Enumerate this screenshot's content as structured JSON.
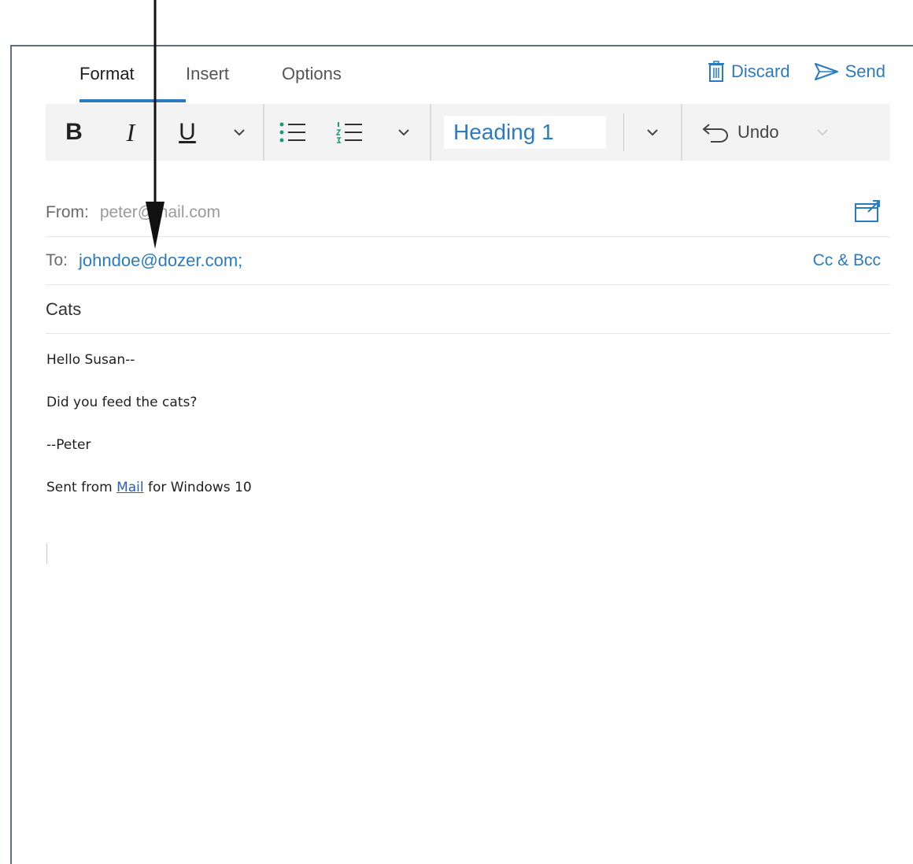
{
  "tabs": [
    {
      "label": "Format",
      "active": true
    },
    {
      "label": "Insert",
      "active": false
    },
    {
      "label": "Options",
      "active": false
    }
  ],
  "actions": {
    "discard": "Discard",
    "send": "Send"
  },
  "toolbar": {
    "bold": "B",
    "italic": "I",
    "underline": "U",
    "style": "Heading 1",
    "undo": "Undo"
  },
  "from": {
    "label": "From:",
    "value": "peter@mail.com"
  },
  "to": {
    "label": "To:",
    "value": "johndoe@dozer.com;",
    "cc_bcc": "Cc & Bcc"
  },
  "subject": "Cats",
  "body": {
    "lines": [
      "Hello Susan--",
      "Did you feed the cats?",
      "--Peter"
    ],
    "signature_prefix": "Sent from ",
    "signature_link": "Mail",
    "signature_suffix": " for Windows 10"
  },
  "colors": {
    "accent": "#2b7bc0",
    "toolbar_bg": "#f3f3f3"
  }
}
